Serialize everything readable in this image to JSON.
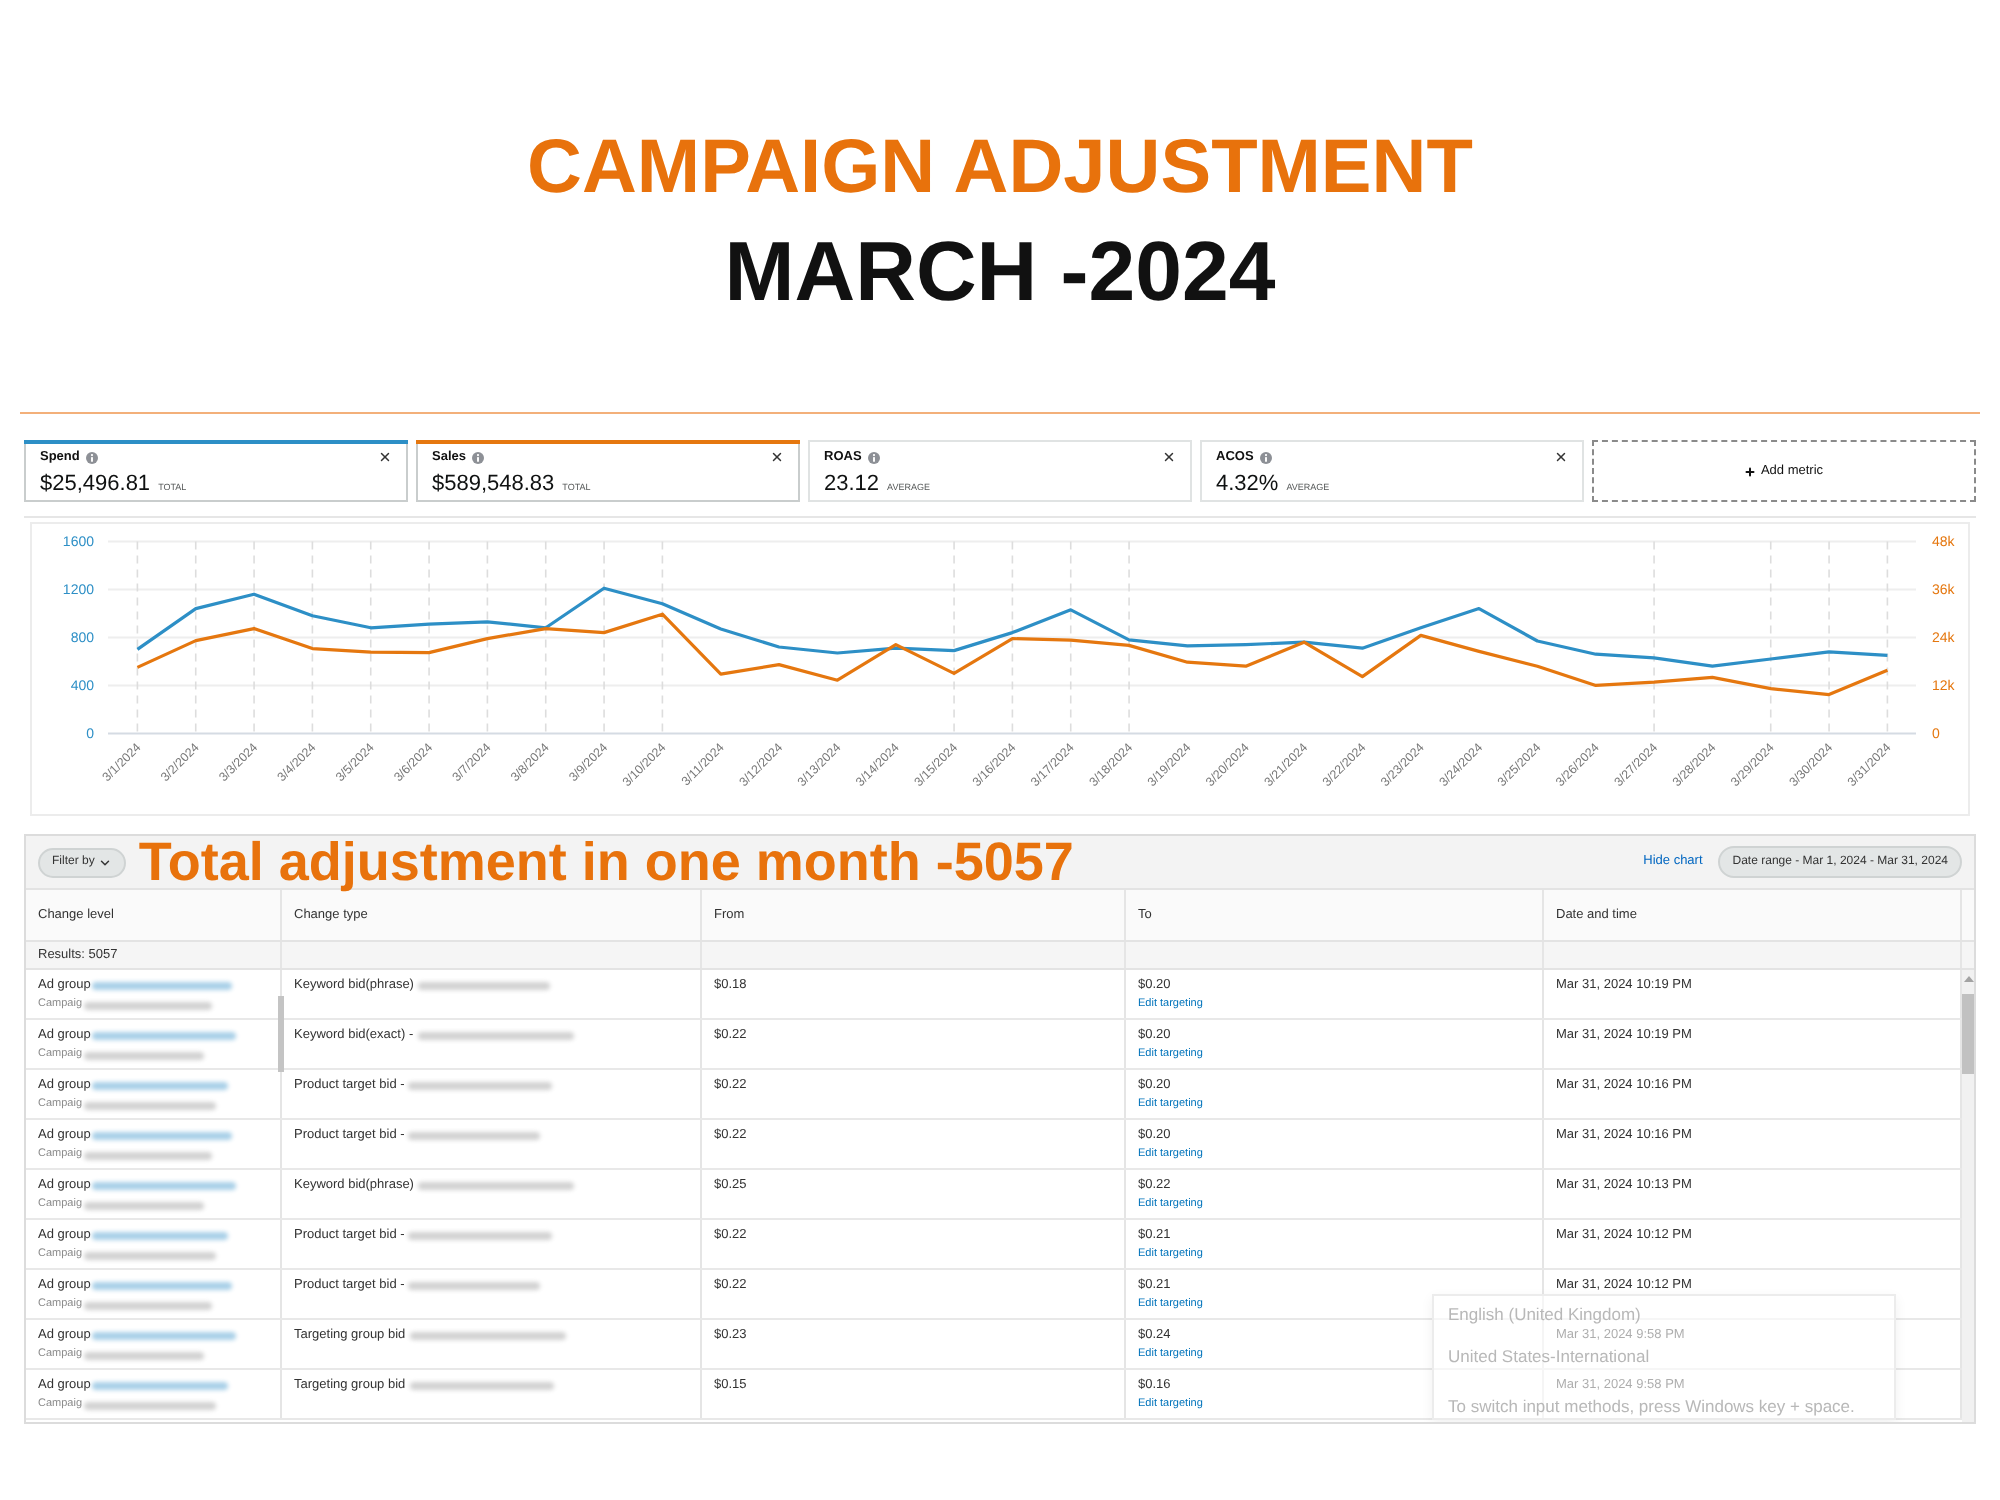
{
  "header": {
    "title": "CAMPAIGN ADJUSTMENT",
    "subtitle": "MARCH -2024"
  },
  "metrics": [
    {
      "label": "Spend",
      "value": "$25,496.81",
      "unit": "TOTAL",
      "selected": true,
      "color": "#2d8fc6"
    },
    {
      "label": "Sales",
      "value": "$589,548.83",
      "unit": "TOTAL",
      "selected": true,
      "color": "#e5770f"
    },
    {
      "label": "ROAS",
      "value": "23.12",
      "unit": "AVERAGE",
      "selected": false
    },
    {
      "label": "ACOS",
      "value": "4.32%",
      "unit": "AVERAGE",
      "selected": false
    }
  ],
  "add_metric": {
    "label": "Add metric"
  },
  "chart": {
    "chart_data": {
      "type": "line",
      "grid": true,
      "categories": [
        "3/1/2024",
        "3/2/2024",
        "3/3/2024",
        "3/4/2024",
        "3/5/2024",
        "3/6/2024",
        "3/7/2024",
        "3/8/2024",
        "3/9/2024",
        "3/10/2024",
        "3/11/2024",
        "3/12/2024",
        "3/13/2024",
        "3/14/2024",
        "3/15/2024",
        "3/16/2024",
        "3/17/2024",
        "3/18/2024",
        "3/19/2024",
        "3/20/2024",
        "3/21/2024",
        "3/22/2024",
        "3/23/2024",
        "3/24/2024",
        "3/25/2024",
        "3/26/2024",
        "3/27/2024",
        "3/28/2024",
        "3/29/2024",
        "3/30/2024",
        "3/31/2024"
      ],
      "series": [
        {
          "color": "#2d8fc6",
          "values": [
            700,
            1040,
            1160,
            980,
            880,
            910,
            930,
            880,
            1210,
            1080,
            870,
            720,
            670,
            710,
            690,
            840,
            1030,
            780,
            730,
            740,
            760,
            710,
            880,
            1040,
            770,
            660,
            630,
            560,
            620,
            680,
            650
          ]
        },
        {
          "color": "#e5770f",
          "axis": "y2",
          "values": [
            16500,
            23200,
            26200,
            21200,
            20300,
            20200,
            23700,
            26200,
            25200,
            29800,
            14800,
            17200,
            13300,
            22200,
            15000,
            23700,
            23300,
            22000,
            17800,
            16800,
            22800,
            14200,
            24500,
            20500,
            16800,
            12000,
            12800,
            14000,
            11200,
            9700,
            15800
          ]
        }
      ],
      "ylim": [
        0,
        1600
      ],
      "yticks": [
        0,
        400,
        800,
        1200,
        1600
      ],
      "y2lim": [
        0,
        48000
      ],
      "y2ticks": [
        {
          "value": 0,
          "label": "0"
        },
        {
          "value": 12000,
          "label": "12k"
        },
        {
          "value": 24000,
          "label": "24k"
        },
        {
          "value": 36000,
          "label": "36k"
        },
        {
          "value": 48000,
          "label": "48k"
        }
      ]
    }
  },
  "toolbar": {
    "filter_button": "Filter by",
    "annotation": "Total adjustment in one month -5057",
    "hide_chart": "Hide chart",
    "date_range": "Date range - Mar 1, 2024 - Mar 31, 2024"
  },
  "table": {
    "columns": [
      "Change level",
      "Change type",
      "From",
      "To",
      "Date and time"
    ],
    "results": "Results: 5057",
    "rows": [
      {
        "level": "Ad group",
        "campaign": "Campaig",
        "change_type": "Keyword bid(phrase)",
        "from": "$0.18",
        "to": "$0.20",
        "link": "Edit targeting",
        "date": "Mar 31, 2024 10:19 PM"
      },
      {
        "level": "Ad group",
        "campaign": "Campaig",
        "change_type": "Keyword bid(exact) -",
        "from": "$0.22",
        "to": "$0.20",
        "link": "Edit targeting",
        "date": "Mar 31, 2024 10:19 PM"
      },
      {
        "level": "Ad group",
        "campaign": "Campaig",
        "change_type": "Product target bid -",
        "from": "$0.22",
        "to": "$0.20",
        "link": "Edit targeting",
        "date": "Mar 31, 2024 10:16 PM"
      },
      {
        "level": "Ad group",
        "campaign": "Campaig",
        "change_type": "Product target bid -",
        "from": "$0.22",
        "to": "$0.20",
        "link": "Edit targeting",
        "date": "Mar 31, 2024 10:16 PM"
      },
      {
        "level": "Ad group",
        "campaign": "Campaig",
        "change_type": "Keyword bid(phrase)",
        "from": "$0.25",
        "to": "$0.22",
        "link": "Edit targeting",
        "date": "Mar 31, 2024 10:13 PM"
      },
      {
        "level": "Ad group",
        "campaign": "Campaig",
        "change_type": "Product target bid -",
        "from": "$0.22",
        "to": "$0.21",
        "link": "Edit targeting",
        "date": "Mar 31, 2024 10:12 PM"
      },
      {
        "level": "Ad group",
        "campaign": "Campaig",
        "change_type": "Product target bid -",
        "from": "$0.22",
        "to": "$0.21",
        "link": "Edit targeting",
        "date": "Mar 31, 2024 10:12 PM"
      },
      {
        "level": "Ad group",
        "campaign": "Campaig",
        "change_type": "Targeting group bid",
        "from": "$0.23",
        "to": "$0.24",
        "link": "Edit targeting",
        "date": "Mar 31, 2024 9:58 PM"
      },
      {
        "level": "Ad group",
        "campaign": "Campaig",
        "change_type": "Targeting group bid",
        "from": "$0.15",
        "to": "$0.16",
        "link": "Edit targeting",
        "date": "Mar 31, 2024 9:58 PM"
      }
    ]
  },
  "input_method_popup": {
    "lines": [
      "English (United Kingdom)",
      "United States-International",
      "To switch input methods, press Windows key + space."
    ]
  }
}
